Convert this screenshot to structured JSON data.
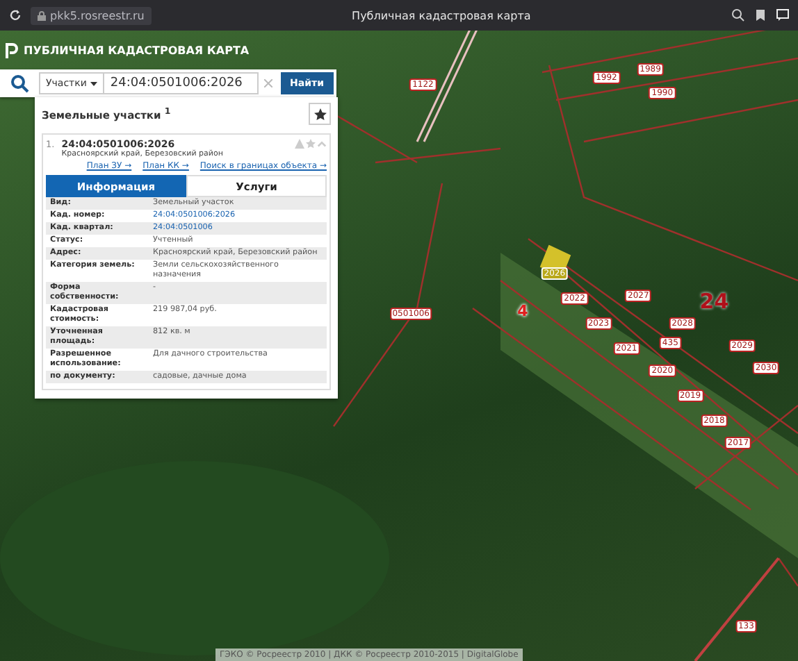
{
  "browser": {
    "url": "pkk5.rosreestr.ru",
    "title": "Публичная кадастровая карта"
  },
  "header": {
    "title": "ПУБЛИЧНАЯ КАДАСТРОВАЯ КАРТА"
  },
  "search": {
    "category": "Участки",
    "value": "24:04:0501006:2026",
    "button": "Найти"
  },
  "results": {
    "title": "Земельные участки",
    "count": "1",
    "item": {
      "index": "1.",
      "number": "24:04:0501006:2026",
      "address": "Красноярский край, Березовский район",
      "links": [
        "План ЗУ →",
        "План КК →",
        "Поиск в границах объекта →"
      ]
    },
    "tabs": [
      {
        "label": "Информация",
        "selected": true
      },
      {
        "label": "Услуги",
        "selected": false
      }
    ],
    "rows": [
      {
        "label": "Вид:",
        "value": "Земельный участок",
        "kind": "text"
      },
      {
        "label": "Кад. номер:",
        "value": "24:04:0501006:2026",
        "kind": "link"
      },
      {
        "label": "Кад. квартал:",
        "value": "24:04:0501006",
        "kind": "link"
      },
      {
        "label": "Статус:",
        "value": "Учтенный",
        "kind": "text"
      },
      {
        "label": "Адрес:",
        "value": "Красноярский край, Березовский район",
        "kind": "text"
      },
      {
        "label": "Категория земель:",
        "value": "Земли сельскохозяйственного назначения",
        "kind": "text"
      },
      {
        "label": "Форма собственности:",
        "value": "-",
        "kind": "text"
      },
      {
        "label": "Кадастровая стоимость:",
        "value": "219 987,04 руб.",
        "kind": "text"
      },
      {
        "label": "Уточненная площадь:",
        "value": "812 кв. м",
        "kind": "text"
      },
      {
        "label": "Разрешенное использование:",
        "value": "Для дачного строительства",
        "kind": "text"
      },
      {
        "label": "по документу:",
        "value": "садовые, дачные дома",
        "kind": "text"
      }
    ]
  },
  "map": {
    "labels": [
      {
        "text": "1122",
        "kind": "small"
      },
      {
        "text": "1992",
        "kind": "small"
      },
      {
        "text": "1989",
        "kind": "small"
      },
      {
        "text": "1990",
        "kind": "small"
      },
      {
        "text": "0501006",
        "kind": "small"
      },
      {
        "text": "4",
        "kind": "medium"
      },
      {
        "text": "2026",
        "kind": "selected"
      },
      {
        "text": "2027",
        "kind": "small"
      },
      {
        "text": "2028",
        "kind": "small"
      },
      {
        "text": "2029",
        "kind": "small"
      },
      {
        "text": "2030",
        "kind": "small"
      },
      {
        "text": "2022",
        "kind": "small"
      },
      {
        "text": "2023",
        "kind": "small"
      },
      {
        "text": "2021",
        "kind": "small"
      },
      {
        "text": "435",
        "kind": "small"
      },
      {
        "text": "2020",
        "kind": "small"
      },
      {
        "text": "2019",
        "kind": "small"
      },
      {
        "text": "2018",
        "kind": "small"
      },
      {
        "text": "2017",
        "kind": "small"
      },
      {
        "text": "24",
        "kind": "big"
      },
      {
        "text": "133",
        "kind": "small"
      }
    ],
    "attribution": "ГЭКО © Росреестр 2010 | ДКК © Росреестр 2010-2015 | DigitalGlobe"
  }
}
